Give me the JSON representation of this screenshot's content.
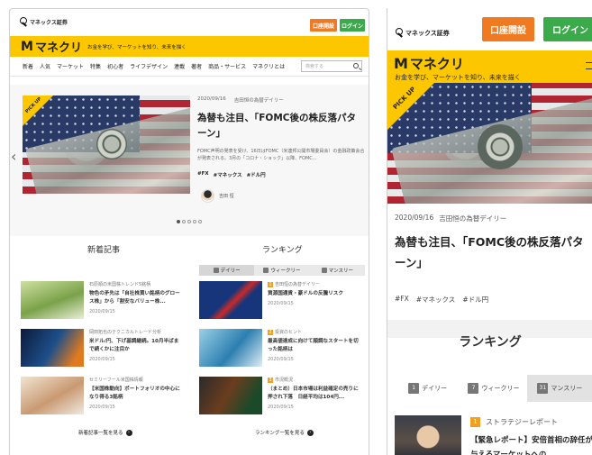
{
  "desktop": {
    "brand_small": "マネックス証券",
    "open_account": "口座開設",
    "login": "ログイン",
    "site_name": "マネクリ",
    "tagline": "お金を学び、マーケットを知り、未来を描く",
    "nav": [
      "新着",
      "人気",
      "マーケット",
      "特集",
      "初心者",
      "ライフデザイン",
      "連載",
      "著者",
      "商品・サービス",
      "マネクリとは"
    ],
    "search_placeholder": "検索する",
    "pickup": {
      "badge": "PICK UP",
      "date": "2020/09/16",
      "series": "吉田恒の為替デイリー",
      "title": "為替も注目、「FOMC後の株反落パターン」",
      "summary": "FOMC声明の発表を受け、16日はFOMC（米連邦公開市場委員会）の金融政策会合が発表される。3月の「コロナ・ショック」以降、FOMC...",
      "tags": [
        "#FX",
        "#マネックス",
        "#ドル円"
      ],
      "author": "吉田 恒"
    },
    "new_heading": "新着記事",
    "ranking_heading": "ランキング",
    "rank_tabs": [
      "デイリー",
      "ウィークリー",
      "マンスリー"
    ],
    "new_articles": [
      {
        "cat": "石原順の米国株トレンド5銘柄",
        "title": "物色の矛先は「自社株買い銘柄のグロース株」から「割安なバリュー株...",
        "date": "2020/09/15"
      },
      {
        "cat": "岡田拓也のテクニカルトレード分析",
        "title": "米ドル/円、下げ基調継続。10月半ばまで続くかに注目か",
        "date": "2020/09/15"
      },
      {
        "cat": "セミリーフール米国株情報",
        "title": "【米国株動向】ポートフォリオの中心になり得る3銘柄",
        "date": "2020/09/15"
      }
    ],
    "ranking_articles": [
      {
        "rank": "1",
        "cat": "吉田恒の為替デイリー",
        "title": "資源国通貨・豪ドルの反騰リスク",
        "date": "2020/09/15"
      },
      {
        "rank": "2",
        "cat": "投資のヒント",
        "title": "最高値達成に向けて順調なスタートを切った銘柄は",
        "date": "2020/09/15"
      },
      {
        "rank": "3",
        "cat": "市況概況",
        "title": "（まとめ）日本市場は利益確定の売りに押され下落　日経平均は104円...",
        "date": "2020/09/15"
      }
    ],
    "more_new": "新着記事一覧を見る",
    "more_rank": "ランキング一覧を見る"
  },
  "mobile": {
    "brand_small": "マネックス証券",
    "open_account": "口座開設",
    "login": "ログイン",
    "site_name": "マネクリ",
    "tagline": "お金を学び、マーケットを知り、未来を描く",
    "pickup_badge": "PICK UP",
    "date": "2020/09/16",
    "series": "吉田恒の為替デイリー",
    "title": "為替も注目、「FOMC後の株反落パターン」",
    "tags": [
      "#FX",
      "#マネックス",
      "#ドル円"
    ],
    "ranking_heading": "ランキング",
    "rank_tabs": [
      {
        "num": "1",
        "label": "デイリー"
      },
      {
        "num": "7",
        "label": "ウィークリー"
      },
      {
        "num": "31",
        "label": "マンスリー"
      }
    ],
    "rank1": {
      "rank": "1",
      "cat": "ストラテジーレポート",
      "title": "【緊急レポート】安倍首相の辞任が与えるマーケットへの"
    }
  }
}
